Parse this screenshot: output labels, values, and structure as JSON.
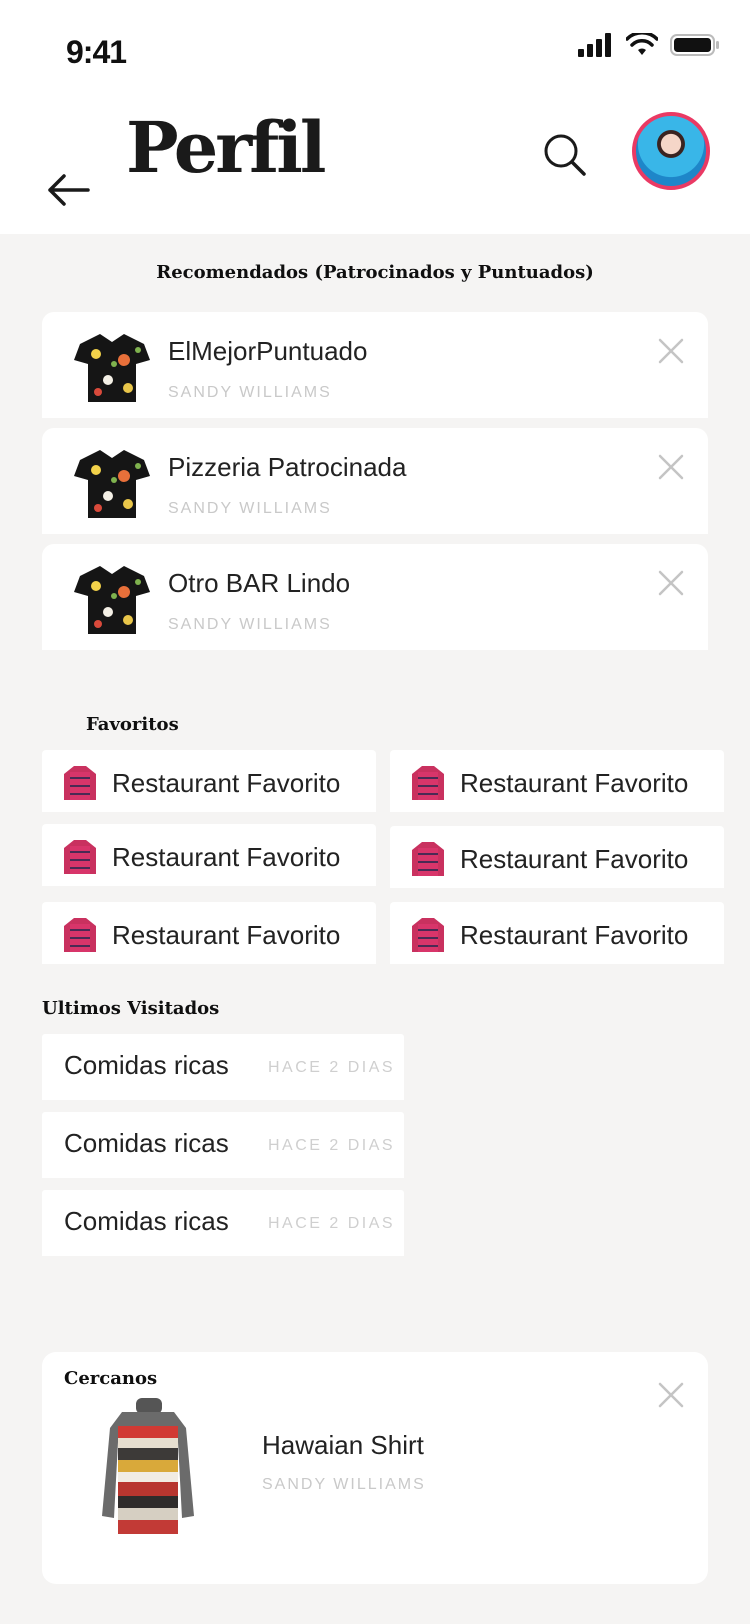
{
  "status_bar": {
    "time": "9:41"
  },
  "header": {
    "title": "Perfil"
  },
  "recommended": {
    "title": "Recomendados (Patrocinados y Puntuados)",
    "items": [
      {
        "name": "ElMejorPuntuado",
        "subtitle": "SANDY WILLIAMS"
      },
      {
        "name": "Pizzeria Patrocinada",
        "subtitle": "SANDY WILLIAMS"
      },
      {
        "name": "Otro BAR Lindo",
        "subtitle": "SANDY WILLIAMS"
      }
    ]
  },
  "favorites": {
    "title": "Favoritos",
    "items": [
      {
        "label": "Restaurant Favorito"
      },
      {
        "label": "Restaurant Favorito"
      },
      {
        "label": "Restaurant Favorito"
      },
      {
        "label": "Restaurant Favorito"
      },
      {
        "label": "Restaurant Favorito"
      },
      {
        "label": "Restaurant Favorito"
      }
    ]
  },
  "recent": {
    "title": "Ultimos Visitados",
    "items": [
      {
        "name": "Comidas ricas",
        "time": "HACE 2 DIAS"
      },
      {
        "name": "Comidas ricas",
        "time": "HACE 2 DIAS"
      },
      {
        "name": "Comidas ricas",
        "time": "HACE 2 DIAS"
      }
    ]
  },
  "nearby": {
    "title": "Cercanos",
    "name": "Hawaian Shirt",
    "subtitle": "SANDY WILLIAMS"
  },
  "colors": {
    "accent": "#ea3a64",
    "background": "#f5f4f3",
    "card": "#ffffff",
    "muted": "#c9c9c9"
  }
}
